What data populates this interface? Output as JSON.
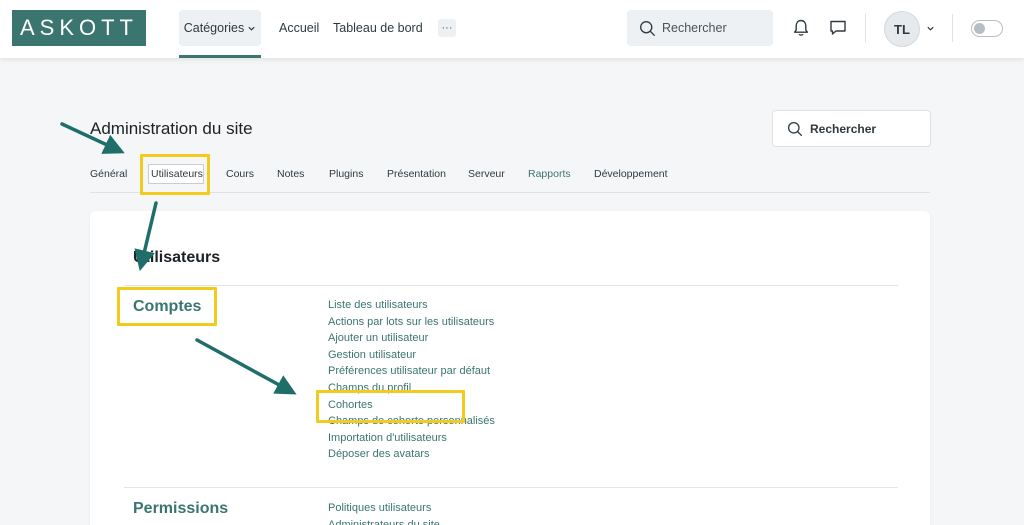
{
  "navbar": {
    "logo": "ASKOTT",
    "categories_label": "Catégories",
    "home_label": "Accueil",
    "dashboard_label": "Tableau de bord",
    "more_label": "···",
    "search_label": "Rechercher",
    "avatar_initials": "TL"
  },
  "page": {
    "title": "Administration du site",
    "search_label": "Rechercher"
  },
  "tabs": [
    {
      "label": "Général"
    },
    {
      "label": "Utilisateurs"
    },
    {
      "label": "Cours"
    },
    {
      "label": "Notes"
    },
    {
      "label": "Plugins"
    },
    {
      "label": "Présentation"
    },
    {
      "label": "Serveur"
    },
    {
      "label": "Rapports"
    },
    {
      "label": "Développement"
    }
  ],
  "content": {
    "section_title": "Utilisateurs",
    "groups": [
      {
        "title": "Comptes",
        "links": [
          "Liste des utilisateurs",
          "Actions par lots sur les utilisateurs",
          "Ajouter un utilisateur",
          "Gestion utilisateur",
          "Préférences utilisateur par défaut",
          "Champs du profil",
          "Cohortes",
          "Champs de cohorte personnalisés",
          "Importation d'utilisateurs",
          "Déposer des avatars"
        ]
      },
      {
        "title": "Permissions",
        "links": [
          "Politiques utilisateurs",
          "Administrateurs du site"
        ]
      }
    ]
  },
  "colors": {
    "brand": "#3b7570",
    "highlight": "#f2cb1d",
    "arrow": "#1f6e6a"
  }
}
